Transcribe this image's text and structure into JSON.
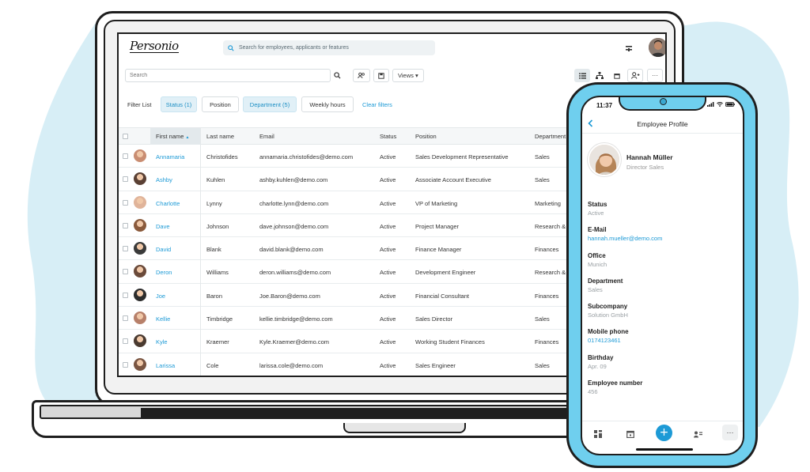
{
  "app": {
    "logo_text": "Personio",
    "global_search_placeholder": "Search for employees, applicants or features"
  },
  "toolbar": {
    "search_placeholder": "Search",
    "views_label": "Views ▾",
    "more_label": "···"
  },
  "filters": {
    "label": "Filter List",
    "chips": [
      {
        "label": "Status (1)",
        "active": true
      },
      {
        "label": "Position",
        "active": false
      },
      {
        "label": "Department (5)",
        "active": true
      },
      {
        "label": "Weekly hours",
        "active": false
      }
    ],
    "clear_label": "Clear filters"
  },
  "table": {
    "columns": [
      "First name",
      "Last name",
      "Email",
      "Status",
      "Position",
      "Department"
    ],
    "sort_indicator": "▲",
    "rows": [
      {
        "first": "Annamaria",
        "last": "Christofides",
        "email": "annamaria.christofides@demo.com",
        "status": "Active",
        "position": "Sales Development Representative",
        "department": "Sales",
        "avatar_color": "#c98d72"
      },
      {
        "first": "Ashby",
        "last": "Kuhlen",
        "email": "ashby.kuhlen@demo.com",
        "status": "Active",
        "position": "Associate Account Executive",
        "department": "Sales",
        "avatar_color": "#5a4034"
      },
      {
        "first": "Charlotte",
        "last": "Lynny",
        "email": "charlotte.lynn@demo.com",
        "status": "Active",
        "position": "VP of Marketing",
        "department": "Marketing",
        "avatar_color": "#e0b49a"
      },
      {
        "first": "Dave",
        "last": "Johnson",
        "email": "dave.johnson@demo.com",
        "status": "Active",
        "position": "Project Manager",
        "department": "Research & D",
        "avatar_color": "#8a5a3c"
      },
      {
        "first": "David",
        "last": "Blank",
        "email": "david.blank@demo.com",
        "status": "Active",
        "position": "Finance Manager",
        "department": "Finances",
        "avatar_color": "#3a3a3a"
      },
      {
        "first": "Deron",
        "last": "Williams",
        "email": "deron.williams@demo.com",
        "status": "Active",
        "position": "Development Engineer",
        "department": "Research & D",
        "avatar_color": "#6b4a3a"
      },
      {
        "first": "Joe",
        "last": "Baron",
        "email": "Joe.Baron@demo.com",
        "status": "Active",
        "position": "Financial Consultant",
        "department": "Finances",
        "avatar_color": "#2c2c2c"
      },
      {
        "first": "Kellie",
        "last": "Timbridge",
        "email": "kellie.timbridge@demo.com",
        "status": "Active",
        "position": "Sales Director",
        "department": "Sales",
        "avatar_color": "#b7806a"
      },
      {
        "first": "Kyle",
        "last": "Kraemer",
        "email": "Kyle.Kraemer@demo.com",
        "status": "Active",
        "position": "Working Student Finances",
        "department": "Finances",
        "avatar_color": "#4a3a30"
      },
      {
        "first": "Larissa",
        "last": "Cole",
        "email": "larissa.cole@demo.com",
        "status": "Active",
        "position": "Sales Engineer",
        "department": "Sales",
        "avatar_color": "#7a5542"
      }
    ]
  },
  "phone": {
    "time": "11:37",
    "title": "Employee Profile",
    "name": "Hannah Müller",
    "role": "Director Sales",
    "fields": [
      {
        "label": "Status",
        "value": "Active",
        "link": false
      },
      {
        "label": "E-Mail",
        "value": "hannah.mueller@demo.com",
        "link": true
      },
      {
        "label": "Office",
        "value": "Munich",
        "link": false
      },
      {
        "label": "Department",
        "value": "Sales",
        "link": false
      },
      {
        "label": "Subcompany",
        "value": "Solution GmbH",
        "link": false
      },
      {
        "label": "Mobile phone",
        "value": "0174123461",
        "link": true
      },
      {
        "label": "Birthday",
        "value": "Apr. 09",
        "link": false
      },
      {
        "label": "Employee number",
        "value": "456",
        "link": false
      }
    ],
    "plus_label": "+",
    "more_label": "···"
  },
  "colors": {
    "accent": "#1d9ad6",
    "phone_body": "#6fcfee",
    "blob": "#d7eef6"
  }
}
